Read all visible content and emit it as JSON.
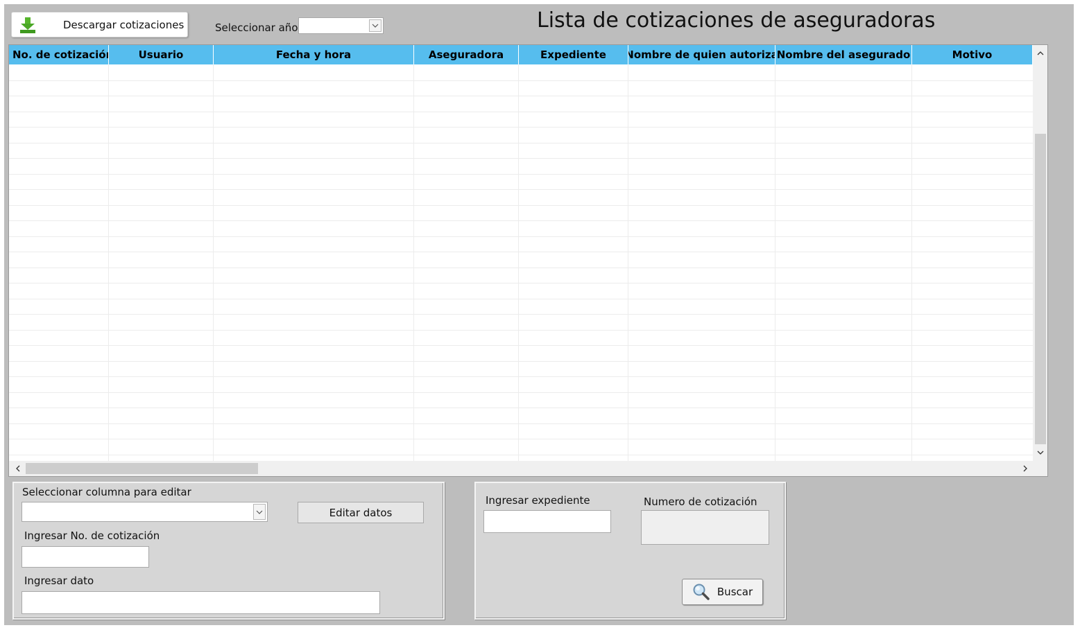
{
  "toolbar": {
    "download_label": "Descargar cotizaciones",
    "year_label": "Seleccionar año",
    "year_value": ""
  },
  "page_title": "Lista de cotizaciones de aseguradoras",
  "table": {
    "columns": [
      "No. de cotización",
      "Usuario",
      "Fecha y hora",
      "Aseguradora",
      "Expediente",
      "Nombre de quien autoriza",
      "Nombre del asegurado",
      "Motivo"
    ],
    "rows": []
  },
  "edit_panel": {
    "column_label": "Seleccionar columna para editar",
    "column_value": "",
    "edit_button": "Editar datos",
    "quote_no_label": "Ingresar No. de cotización",
    "quote_no_value": "",
    "data_label": "Ingresar dato",
    "data_value": ""
  },
  "search_panel": {
    "expediente_label": "Ingresar expediente",
    "expediente_value": "",
    "quote_number_label": "Numero de cotización",
    "quote_number_value": "",
    "search_button": "Buscar"
  },
  "colors": {
    "header_bg": "#56bdee",
    "window_bg": "#bdbdbd",
    "panel_bg": "#d6d6d6",
    "download_icon": "#3f9a1f"
  },
  "icons": {
    "download": "download-arrow-icon",
    "search": "magnifier-icon",
    "dropdown": "chevron-down-icon"
  }
}
